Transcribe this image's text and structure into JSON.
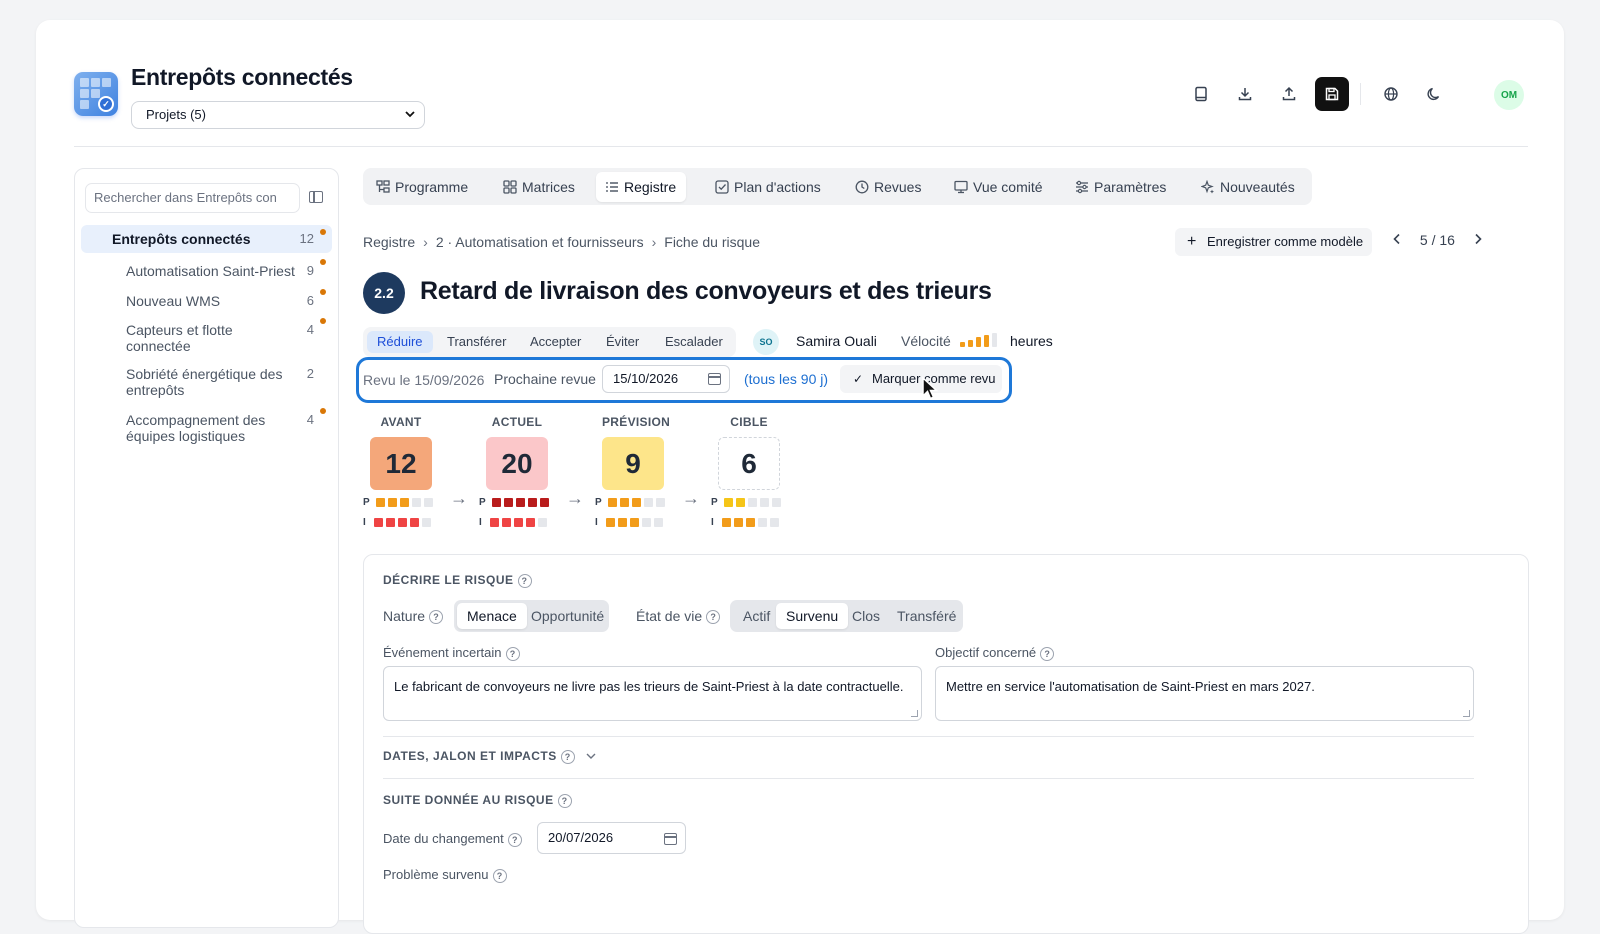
{
  "app": {
    "title": "Entrepôts connectés",
    "avatar_initials": "OM"
  },
  "project_select": {
    "value": "Projets (5)"
  },
  "sidebar": {
    "search_placeholder": "Rechercher dans Entrepôts con",
    "root": {
      "label": "Entrepôts connectés",
      "count": "12"
    },
    "items": [
      {
        "label": "Automatisation Saint-Priest",
        "count": "9",
        "dot": true
      },
      {
        "label": "Nouveau WMS",
        "count": "6",
        "dot": true
      },
      {
        "label": "Capteurs et flotte connectée",
        "count": "4",
        "dot": true
      },
      {
        "label": "Sobriété énergétique des entrepôts",
        "count": "2",
        "dot": false
      },
      {
        "label": "Accompagnement des équipes logistiques",
        "count": "4",
        "dot": true
      }
    ]
  },
  "tabs": [
    {
      "label": "Programme",
      "icon": "hierarchy-icon"
    },
    {
      "label": "Matrices",
      "icon": "grid-icon"
    },
    {
      "label": "Registre",
      "icon": "list-icon",
      "active": true
    },
    {
      "label": "Plan d'actions",
      "icon": "checkbox-icon"
    },
    {
      "label": "Revues",
      "icon": "clock-icon"
    },
    {
      "label": "Vue comité",
      "icon": "monitor-icon"
    },
    {
      "label": "Paramètres",
      "icon": "sliders-icon"
    },
    {
      "label": "Nouveautés",
      "icon": "sparkle-icon"
    }
  ],
  "breadcrumb": {
    "items": [
      "Registre",
      "2 · Automatisation et fournisseurs",
      "Fiche du risque"
    ]
  },
  "actions": {
    "save_model": "Enregistrer comme modèle",
    "pager": "5 / 16"
  },
  "risk": {
    "id": "2.2",
    "title": "Retard de livraison des convoyeurs et des trieurs"
  },
  "strategies": [
    {
      "label": "Réduire",
      "active": true
    },
    {
      "label": "Transférer"
    },
    {
      "label": "Accepter"
    },
    {
      "label": "Éviter"
    },
    {
      "label": "Escalader"
    }
  ],
  "owner": {
    "initials": "SO",
    "name": "Samira Ouali"
  },
  "velocity": {
    "label": "Vélocité",
    "value": "heures",
    "level": 4,
    "max": 5
  },
  "review": {
    "reviewed": "Revu le 15/09/2026",
    "next_label": "Prochaine revue",
    "next_date": "15/10/2026",
    "frequency": "(tous les 90 j)",
    "mark_button": "Marquer comme revu"
  },
  "scores": [
    {
      "header": "AVANT",
      "value": "12",
      "bg": "#f4a77a",
      "p": 3,
      "i": 4,
      "p_color": "#f29c1a",
      "i_color": "#ef4444"
    },
    {
      "header": "ACTUEL",
      "value": "20",
      "bg": "#fbc7c9",
      "p": 5,
      "i": 4,
      "p_color": "#b91c1c",
      "i_color": "#ef4444"
    },
    {
      "header": "PRÉVISION",
      "value": "9",
      "bg": "#fde58a",
      "p": 3,
      "i": 3,
      "p_color": "#f29c1a",
      "i_color": "#f29c1a"
    },
    {
      "header": "CIBLE",
      "value": "6",
      "bg": "#ffffff",
      "p": 2,
      "i": 3,
      "p_color": "#f5c518",
      "i_color": "#f29c1a"
    }
  ],
  "score_row_labels": {
    "p": "P",
    "i": "I"
  },
  "describe": {
    "heading": "DÉCRIRE LE RISQUE",
    "nature_label": "Nature",
    "nature_options": [
      {
        "label": "Menace",
        "active": true
      },
      {
        "label": "Opportunité"
      }
    ],
    "state_label": "État de vie",
    "state_options": [
      {
        "label": "Actif"
      },
      {
        "label": "Survenu",
        "active": true
      },
      {
        "label": "Clos"
      },
      {
        "label": "Transféré"
      }
    ],
    "event_label": "Événement incertain",
    "event_value": "Le fabricant de convoyeurs ne livre pas les trieurs de Saint-Priest à la date contractuelle.",
    "objective_label": "Objectif concerné",
    "objective_value": "Mettre en service l'automatisation de Saint-Priest en mars 2027."
  },
  "dates_section": {
    "heading": "DATES, JALON ET IMPACTS"
  },
  "followup": {
    "heading": "SUITE DONNÉE AU RISQUE",
    "change_date_label": "Date du changement",
    "change_date": "20/07/2026",
    "problem_label": "Problème survenu"
  },
  "help_glyph": "?"
}
